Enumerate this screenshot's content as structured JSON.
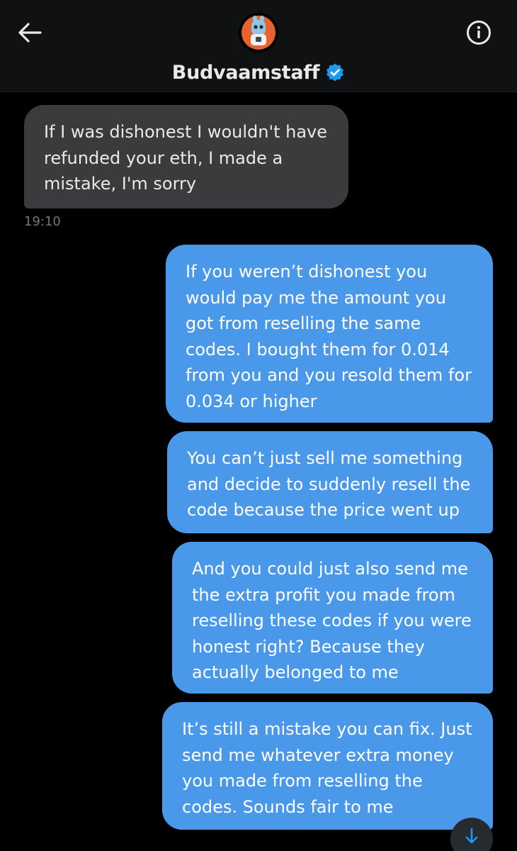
{
  "header": {
    "title": "Budvaamstaff",
    "back_icon": "arrow-left-icon",
    "info_icon": "info-circle-icon",
    "verified_icon": "verified-badge-icon",
    "accent": "#1d9bf0"
  },
  "messages": [
    {
      "direction": "incoming",
      "text": "If I was dishonest I wouldn't have refunded your eth, I made a mistake, I'm sorry",
      "time": "19:10"
    },
    {
      "direction": "outgoing",
      "text": "If you weren’t dishonest you would pay me the amount you got from reselling the same codes. I bought them for 0.014 from you and you resold them for 0.034 or higher"
    },
    {
      "direction": "outgoing",
      "text": "You can’t just sell me something and decide to suddenly resell the code because the price went up"
    },
    {
      "direction": "outgoing",
      "text": "And you could just also send me the extra profit you made from reselling these codes if you were honest right? Because they actually belonged to me"
    },
    {
      "direction": "outgoing",
      "text": "It’s still a mistake you can fix. Just send me whatever extra money you made from reselling the codes. Sounds fair to me"
    }
  ],
  "scroll_button": {
    "icon": "arrow-down-icon"
  },
  "colors": {
    "background": "#000000",
    "incoming_bubble": "#3a3b3d",
    "outgoing_bubble": "#4a98e9",
    "timestamp": "#71767b"
  }
}
